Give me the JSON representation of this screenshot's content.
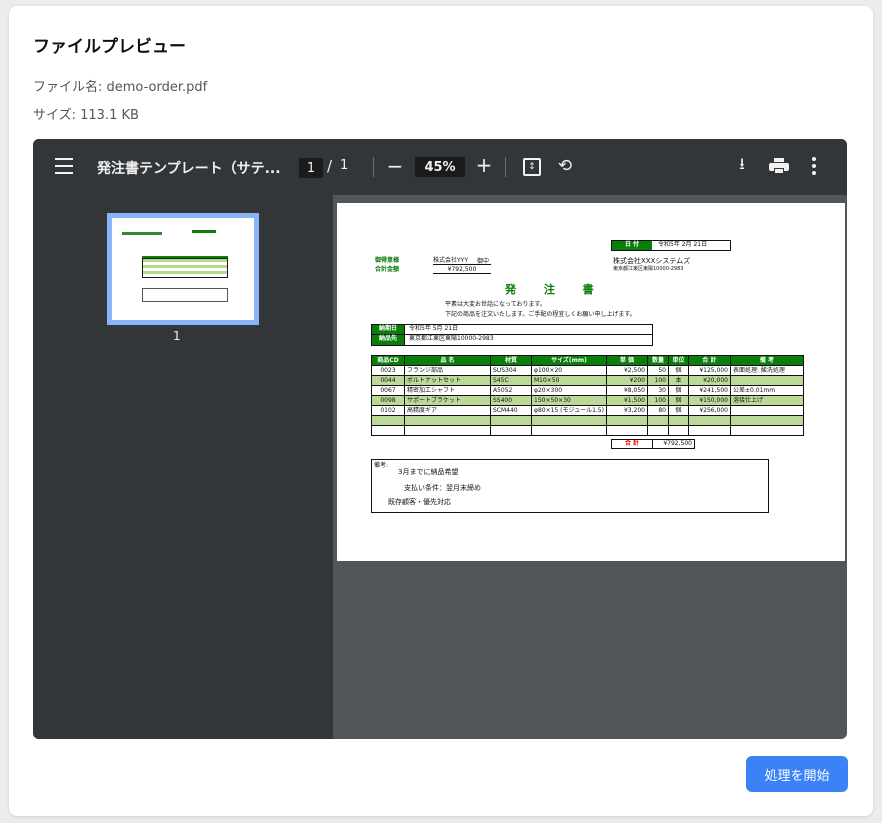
{
  "header": {
    "title": "ファイルプレビュー"
  },
  "meta": {
    "file_name": "ファイル名: demo-order.pdf",
    "size": "サイズ: 113.1 KB"
  },
  "viewer": {
    "doc_title": "発注書テンプレート（サテ...",
    "page_current": "1",
    "page_sep": "/",
    "page_total": "1",
    "zoom": "45%",
    "zoom_out": "−",
    "zoom_in": "+",
    "thumbnail_label": "1",
    "icons": [
      "menu-icon",
      "fit-page-icon",
      "rotate-icon",
      "download-icon",
      "print-icon",
      "more-vert-icon"
    ]
  },
  "document": {
    "date_label": "日 付",
    "date_value": "令和5年 2月 21日",
    "recipient_label": "御得意様",
    "recipient_name": "株式会社YYY",
    "onchu": "御中",
    "supplier_name": "株式会社XXXシステムズ",
    "supplier_address": "東京都江東区東陽10000-2983",
    "total_label": "合計金額",
    "total_value": "¥792,500",
    "doc_heading": "発 注 書",
    "greeting1": "平素は大変お世話になっております。",
    "greeting2": "下記の商品を注文いたします。ご手配の程宜しくお願い申し上げます。",
    "delivery_date_label": "納期日",
    "delivery_date": "令和5年 5月 21日",
    "delivery_place_label": "納品先",
    "delivery_place": "東京都江東区東陽10000-2983",
    "columns": [
      "商品CD",
      "品 名",
      "材質",
      "サイズ(mm)",
      "単 価",
      "数量",
      "単位",
      "合 計",
      "備 考"
    ],
    "rows": [
      [
        "0023",
        "フランジ部品",
        "SUS304",
        "φ100×20",
        "¥2,500",
        "50",
        "個",
        "¥125,000",
        "表面処理: 酸洗処理"
      ],
      [
        "0044",
        "ボルトナットセット",
        "S45C",
        "M10×50",
        "¥200",
        "100",
        "本",
        "¥20,000",
        ""
      ],
      [
        "0067",
        "精密加工シャフト",
        "A5052",
        "φ20×300",
        "¥8,050",
        "30",
        "個",
        "¥241,500",
        "公差±0.01mm"
      ],
      [
        "0098",
        "サポートブラケット",
        "SS400",
        "150×50×30",
        "¥1,500",
        "100",
        "個",
        "¥150,000",
        "溶接仕上げ"
      ],
      [
        "0102",
        "高精度ギア",
        "SCM440",
        "φ80×15 (モジュール1.5)",
        "¥3,200",
        "80",
        "個",
        "¥256,000",
        ""
      ]
    ],
    "sum_label": "合 計",
    "sum_value": "¥792,500",
    "notes_label": "備考:",
    "note1": "3月までに納品希望",
    "note2": "支払い条件：翌月末締め",
    "note3": "既存顧客・優先対応"
  },
  "actions": {
    "start": "処理を開始"
  }
}
